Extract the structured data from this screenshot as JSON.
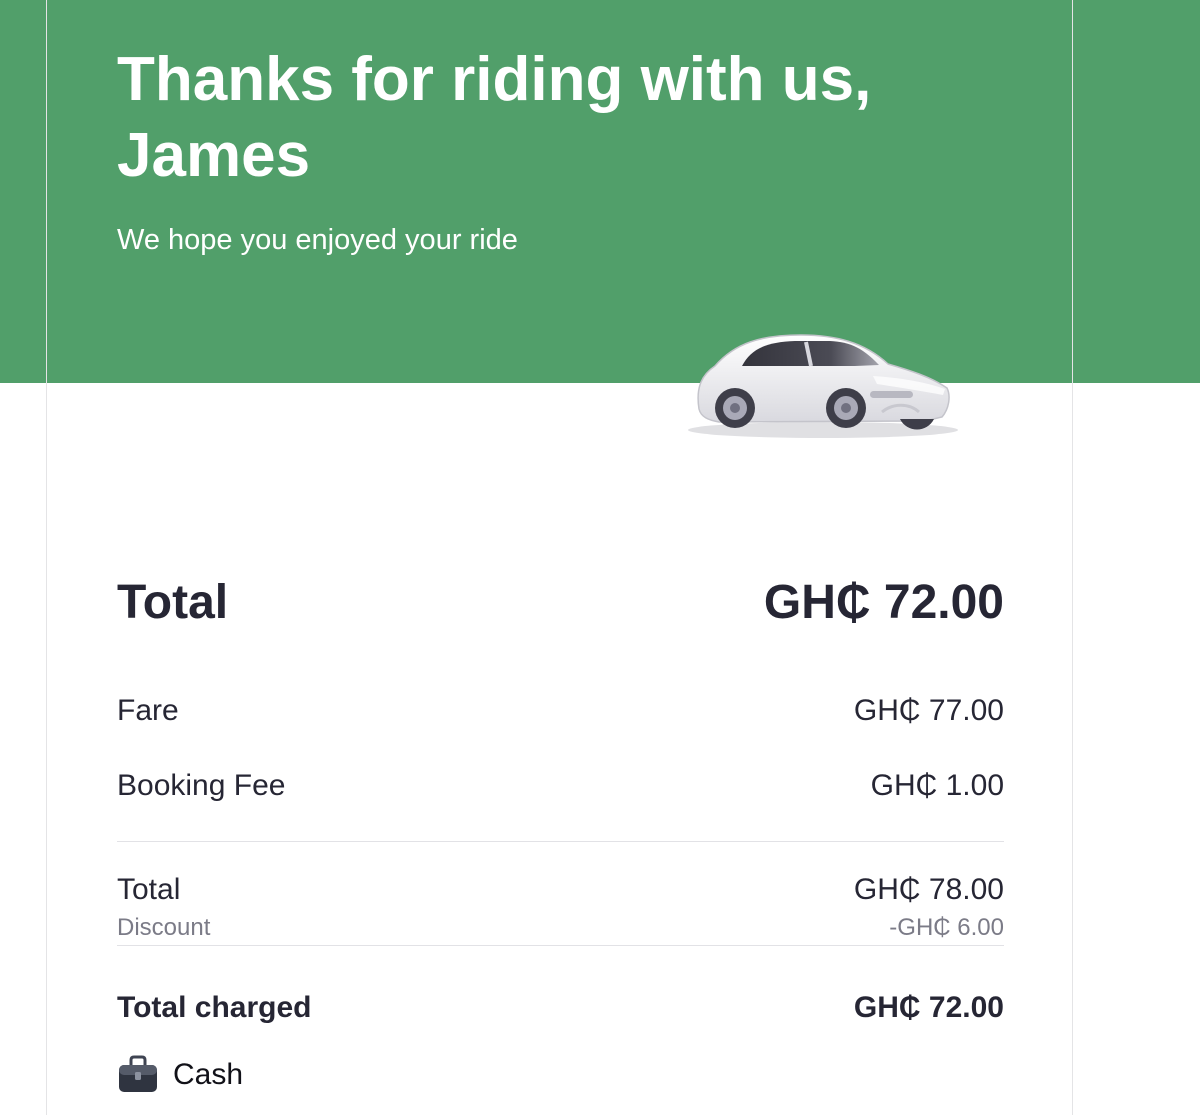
{
  "header": {
    "title": "Thanks for riding with us, James",
    "subtitle": "We hope you enjoyed your ride",
    "background_color": "#519f6a",
    "illustration_icon": "car-icon"
  },
  "receipt": {
    "total": {
      "label": "Total",
      "amount": "GH₵ 72.00"
    },
    "line_items": [
      {
        "label": "Fare",
        "amount": "GH₵ 77.00"
      },
      {
        "label": "Booking Fee",
        "amount": "GH₵ 1.00"
      }
    ],
    "subtotal": {
      "label": "Total",
      "amount": "GH₵ 78.00"
    },
    "discount": {
      "label": "Discount",
      "amount": "-GH₵ 6.00"
    },
    "charged": {
      "label": "Total charged",
      "amount": "GH₵ 72.00"
    },
    "payment": {
      "icon": "briefcase-icon",
      "method": "Cash"
    }
  }
}
